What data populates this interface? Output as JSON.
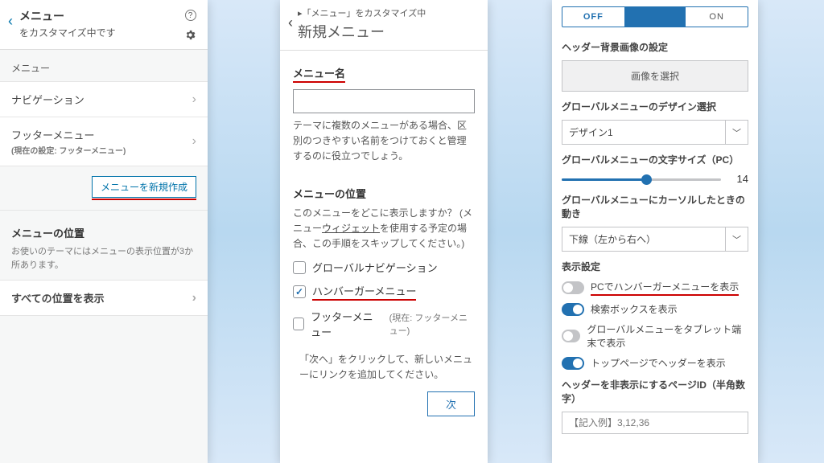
{
  "panel1": {
    "back": "‹",
    "title": "メニュー",
    "subtitle": "をカスタマイズ中です",
    "help_icon": "?",
    "menus_label": "メニュー",
    "items": [
      {
        "label": "ナビゲーション",
        "sub": ""
      },
      {
        "label": "フッターメニュー",
        "sub": "(現在の設定: フッターメニュー)"
      }
    ],
    "create_button": "メニューを新規作成",
    "position_heading": "メニューの位置",
    "position_help": "お使いのテーマにはメニューの表示位置が3か所あります。",
    "show_all": "すべての位置を表示"
  },
  "panel2": {
    "back": "‹",
    "breadcrumb": "▸「メニュー」をカスタマイズ中",
    "title": "新規メニュー",
    "name_label": "メニュー名",
    "name_value": "",
    "name_help": "テーマに複数のメニューがある場合、区別のつきやすい名前をつけておくと管理するのに役立つでしょう。",
    "pos_heading": "メニューの位置",
    "pos_help_a": "このメニューをどこに表示しますか？ (メニュー",
    "pos_help_link": "ウィジェット",
    "pos_help_b": "を使用する予定の場合、この手順をスキップしてください。)",
    "checkboxes": [
      {
        "label": "グローバルナビゲーション",
        "checked": false,
        "sub": ""
      },
      {
        "label": "ハンバーガーメニュー",
        "checked": true,
        "sub": ""
      },
      {
        "label": "フッターメニュー",
        "checked": false,
        "sub": "(現在: フッターメニュー)"
      }
    ],
    "next_hint": "「次へ」をクリックして、新しいメニューにリンクを追加してください。",
    "next": "次"
  },
  "panel3": {
    "segment": {
      "off": "OFF",
      "on": "ON"
    },
    "header_bg_heading": "ヘッダー背景画像の設定",
    "select_image": "画像を選択",
    "design_heading": "グローバルメニューのデザイン選択",
    "design_value": "デザイン1",
    "fontsize_heading": "グローバルメニューの文字サイズ（PC）",
    "fontsize_value": "14",
    "hover_heading": "グローバルメニューにカーソルしたときの動き",
    "hover_value": "下線（左から右へ）",
    "display_heading": "表示設定",
    "toggles": [
      {
        "label": "PCでハンバーガーメニューを表示",
        "on": false,
        "u": true
      },
      {
        "label": "検索ボックスを表示",
        "on": true
      },
      {
        "label": "グローバルメニューをタブレット端末で表示",
        "on": false
      },
      {
        "label": "トップページでヘッダーを表示",
        "on": true
      }
    ],
    "hide_heading": "ヘッダーを非表示にするページID（半角数字）",
    "hide_placeholder": "【記入例】3,12,36"
  }
}
